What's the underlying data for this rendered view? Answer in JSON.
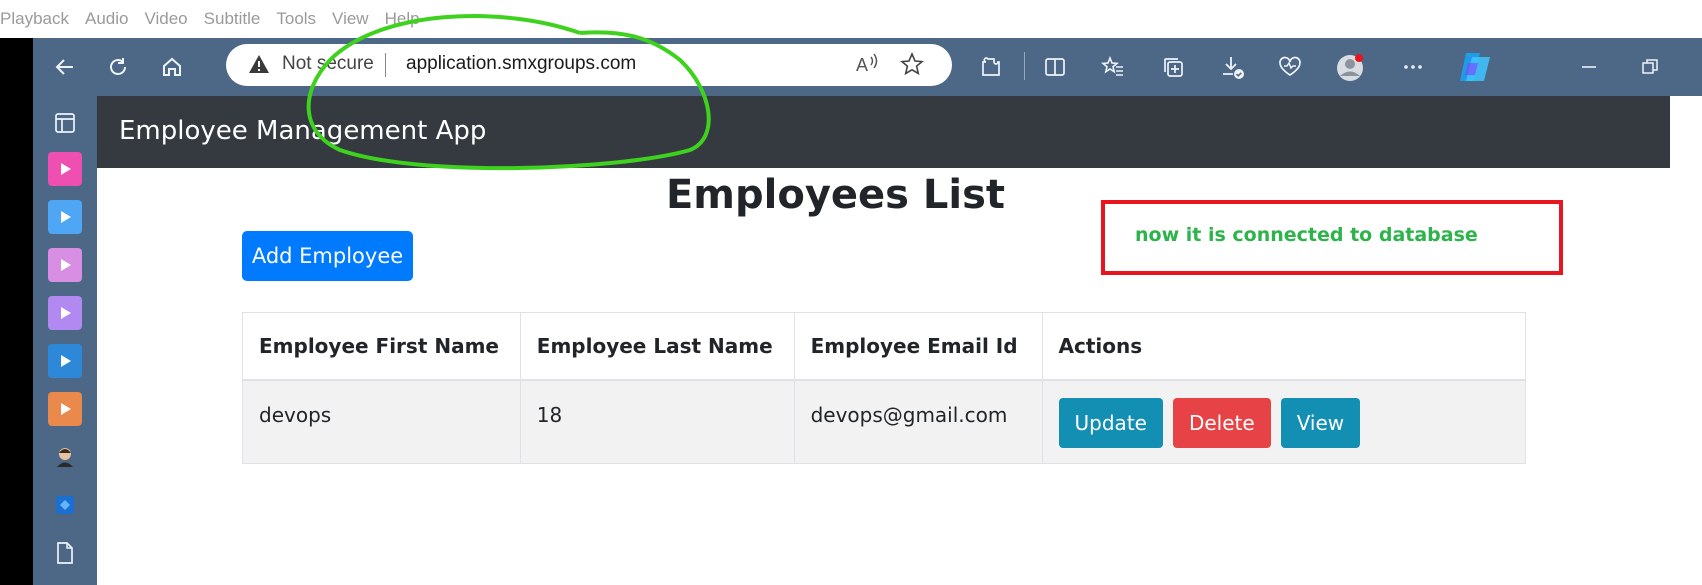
{
  "player_menu": [
    "Playback",
    "Audio",
    "Video",
    "Subtitle",
    "Tools",
    "View",
    "Help"
  ],
  "browser": {
    "address": {
      "security_label": "Not secure",
      "url": "application.smxgroups.com"
    },
    "toolbar_icons": [
      "back-icon",
      "refresh-icon",
      "home-icon",
      "extensions-icon",
      "split-screen-icon",
      "favorites-icon",
      "collections-icon",
      "downloads-icon",
      "browser-essentials-icon",
      "profile-icon",
      "more-icon",
      "copilot-icon",
      "minimize-icon",
      "restore-icon"
    ]
  },
  "sidebar_icons": [
    "tab-actions-icon",
    "video-app-icon",
    "video-app-icon",
    "video-app-icon",
    "video-app-icon",
    "video-app-icon",
    "video-app-icon",
    "person-icon",
    "app-icon",
    "file-icon"
  ],
  "app": {
    "brand": "Employee Management App",
    "page_title": "Employees List",
    "add_button": "Add Employee",
    "note": "now it is connected to database",
    "table": {
      "headers": [
        "Employee First Name",
        "Employee Last Name",
        "Employee Email Id",
        "Actions"
      ],
      "rows": [
        {
          "first": "devops",
          "last": "18",
          "email": "devops@gmail.com"
        }
      ],
      "actions": {
        "update": "Update",
        "delete": "Delete",
        "view": "View"
      }
    }
  },
  "colors": {
    "browser_chrome": "#4c6886",
    "navbar": "#343a40",
    "primary": "#007bff",
    "info": "#138fb4",
    "danger": "#e74346",
    "annotation_red": "#e8141e",
    "annotation_green": "#2cb34a",
    "scribble_green": "#3ed21e"
  }
}
